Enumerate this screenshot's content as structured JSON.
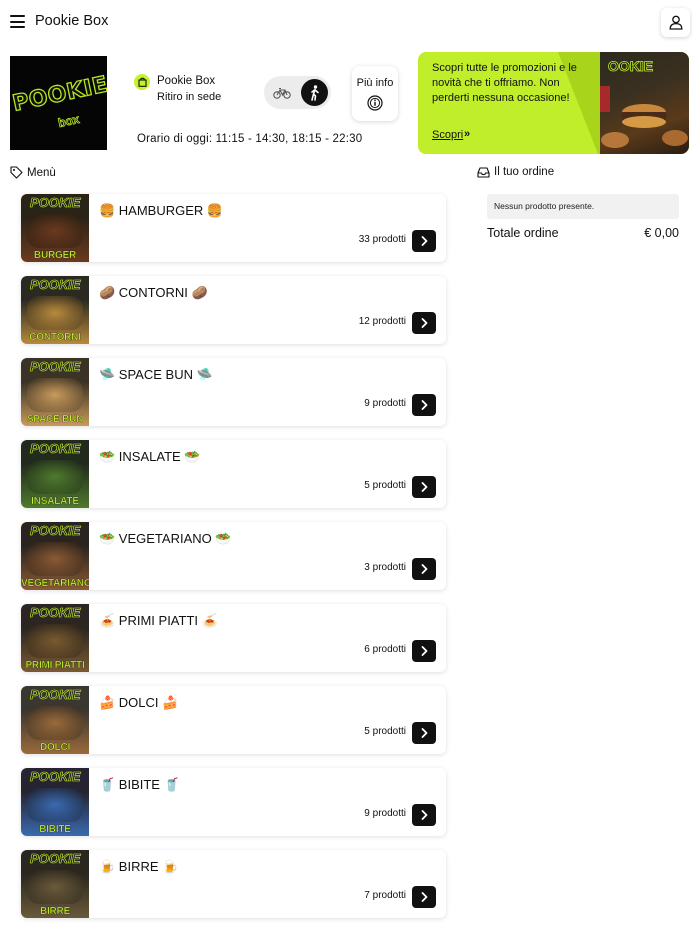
{
  "header": {
    "title": "Pookie Box"
  },
  "store": {
    "logo_text": "POOKIE",
    "logo_sub": "box",
    "name": "Pookie Box",
    "mode": "Ritiro in sede",
    "more_info_label": "Più info",
    "hours": "Orario di oggi: 11:15 - 14:30, 18:15 - 22:30"
  },
  "promo": {
    "text": "Scopri tutte le promozioni e le novità che ti offriamo. Non perderti nessuna occasione!",
    "link_label": "Scopri",
    "photo_logo": "OOKIE"
  },
  "menu": {
    "header": "Menù",
    "categories": [
      {
        "name": "🍔 HAMBURGER 🍔",
        "count": "33 prodotti",
        "thumb_label": "BURGER",
        "thumb_logo": "POOKIE"
      },
      {
        "name": "🥔 CONTORNI 🥔",
        "count": "12 prodotti",
        "thumb_label": "CONTORNI",
        "thumb_logo": "POOKIE"
      },
      {
        "name": "🛸 SPACE BUN 🛸",
        "count": "9 prodotti",
        "thumb_label": "SPACE BUN",
        "thumb_logo": "POOKIE"
      },
      {
        "name": "🥗 INSALATE 🥗",
        "count": "5 prodotti",
        "thumb_label": "INSALATE",
        "thumb_logo": "POOKIE"
      },
      {
        "name": "🥗 VEGETARIANO 🥗",
        "count": "3 prodotti",
        "thumb_label": "VEGETARIANO",
        "thumb_logo": "POOKIE"
      },
      {
        "name": "🍝 PRIMI PIATTI 🍝",
        "count": "6 prodotti",
        "thumb_label": "PRIMI PIATTI",
        "thumb_logo": "POOKIE"
      },
      {
        "name": "🍰 DOLCI 🍰",
        "count": "5 prodotti",
        "thumb_label": "DOLCI",
        "thumb_logo": "POOKIE"
      },
      {
        "name": "🥤 BIBITE 🥤",
        "count": "9 prodotti",
        "thumb_label": "BIBITE",
        "thumb_logo": "POOKIE"
      },
      {
        "name": "🍺 BIRRE 🍺",
        "count": "7 prodotti",
        "thumb_label": "BIRRE",
        "thumb_logo": "POOKIE"
      }
    ]
  },
  "order": {
    "header": "Il tuo ordine",
    "empty_text": "Nessun prodotto presente.",
    "total_label": "Totale ordine",
    "total_value": "€ 0,00"
  },
  "colors": {
    "accent": "#c5f22a",
    "dark": "#111111"
  }
}
